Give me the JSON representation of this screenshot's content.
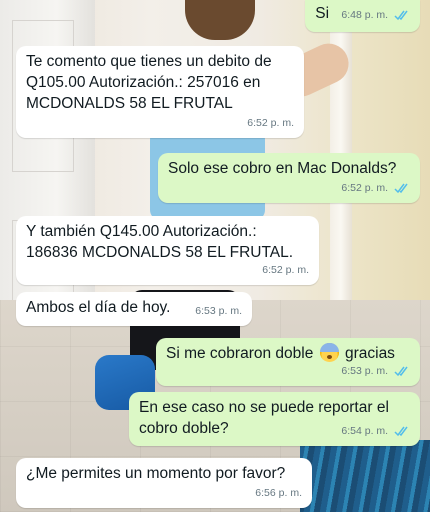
{
  "messages": [
    {
      "dir": "out",
      "text": "Si",
      "time": "6:48 p. m.",
      "read": true
    },
    {
      "dir": "in",
      "text": "Te comento que tienes un debito de Q105.00  Autorización.: 257016 en MCDONALDS 58 EL FRUTAL",
      "time": "6:52 p. m."
    },
    {
      "dir": "out",
      "text": "Solo ese cobro en Mac Donalds?",
      "time": "6:52 p. m.",
      "read": true
    },
    {
      "dir": "in",
      "text": "Y también Q145.00  Autorización.: 186836  MCDONALDS 58 EL FRUTAL.",
      "time": "6:52 p. m."
    },
    {
      "dir": "in",
      "text": "Ambos el día de hoy.",
      "time": "6:53 p. m."
    },
    {
      "dir": "out",
      "text_before": "Si me cobraron doble",
      "emoji": "anxious-face-emoji",
      "text_after": "gracias",
      "time": "6:53 p. m.",
      "read": true
    },
    {
      "dir": "out",
      "text": "En ese caso no se puede reportar el cobro doble?",
      "time": "6:54 p. m.",
      "read": true
    },
    {
      "dir": "in",
      "text": "¿Me permites un momento por favor?",
      "time": "6:56 p. m."
    }
  ],
  "colors": {
    "incoming": "#ffffff",
    "outgoing": "#dcf8c6",
    "read_tick": "#53bdeb",
    "time": "#667781"
  }
}
